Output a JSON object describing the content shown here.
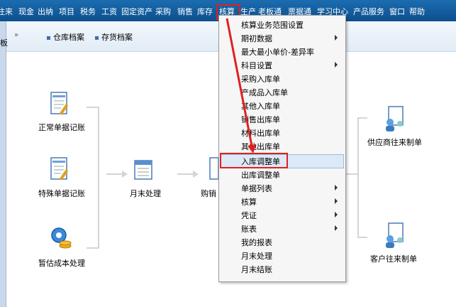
{
  "menubar": {
    "items": [
      "往来",
      "现金",
      "出纳",
      "项目",
      "税务",
      "工资",
      "固定资产",
      "采购",
      "销售",
      "库存",
      "核算",
      "生产",
      "老板通",
      "票据通",
      "学习中心",
      "产品服务",
      "窗口",
      "帮助"
    ],
    "active": "核算"
  },
  "tabstrip": {
    "left_tag": "板",
    "chevrons": "»",
    "tabs": [
      "仓库档案",
      "存货档案"
    ]
  },
  "flow": {
    "nodes": [
      {
        "key": "normal",
        "label": "正常单据记账",
        "icon": "document-pen-icon"
      },
      {
        "key": "special",
        "label": "特殊单据记账",
        "icon": "document-pen-icon"
      },
      {
        "key": "estimate",
        "label": "暂估成本处理",
        "icon": "gear-coins-icon"
      },
      {
        "key": "month",
        "label": "月末处理",
        "icon": "calendar-icon"
      },
      {
        "key": "buysell",
        "label": "购销",
        "icon": "document-icon"
      },
      {
        "key": "supplier",
        "label": "供应商往来制单",
        "icon": "people-document-icon"
      },
      {
        "key": "customer",
        "label": "客户往来制单",
        "icon": "people-document-icon"
      }
    ]
  },
  "dropdown": {
    "items": [
      {
        "label": "核算业务范围设置",
        "submenu": false
      },
      {
        "label": "期初数据",
        "submenu": true
      },
      {
        "label": "最大最小单价-差异率",
        "submenu": false
      },
      {
        "label": "科目设置",
        "submenu": true
      },
      {
        "label": "采购入库单",
        "submenu": false
      },
      {
        "label": "产成品入库单",
        "submenu": false
      },
      {
        "label": "其他入库单",
        "submenu": false
      },
      {
        "label": "销售出库单",
        "submenu": false
      },
      {
        "label": "材料出库单",
        "submenu": false
      },
      {
        "label": "其他出库单",
        "submenu": false
      },
      {
        "label": "入库调整单",
        "submenu": false
      },
      {
        "label": "出库调整单",
        "submenu": false
      },
      {
        "label": "单据列表",
        "submenu": true
      },
      {
        "label": "核算",
        "submenu": true
      },
      {
        "label": "凭证",
        "submenu": true
      },
      {
        "label": "账表",
        "submenu": true
      },
      {
        "label": "我的报表",
        "submenu": false
      },
      {
        "label": "月末处理",
        "submenu": false
      },
      {
        "label": "月末结账",
        "submenu": false
      }
    ],
    "selected": "入库调整单"
  },
  "colors": {
    "menubar": "#0c4f8e",
    "highlight_border": "#e02020",
    "annotation": "#e02020"
  }
}
